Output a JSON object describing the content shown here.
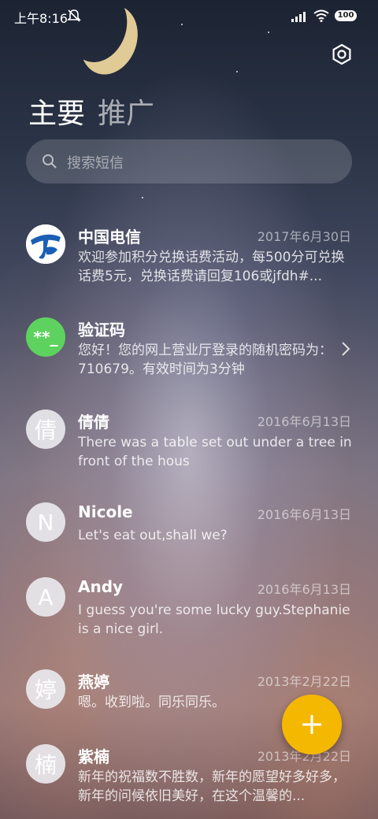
{
  "status_bar": {
    "time": "上午8:16",
    "battery": "100"
  },
  "tabs": {
    "main": "主要",
    "promotions": "推广"
  },
  "search": {
    "placeholder": "搜索短信"
  },
  "messages": [
    {
      "name": "中国电信",
      "date": "2017年6月30日",
      "preview": "欢迎参加积分兑换话费活动，每500分可兑换话费5元，兑换话费请回复106或jfdh#..."
    },
    {
      "name": "验证码",
      "avatar_text": "**_",
      "preview": "您好！您的网上营业厅登录的随机密码为：710679。有效时间为3分钟"
    },
    {
      "name": "倩倩",
      "avatar_text": "倩",
      "date": "2016年6月13日",
      "preview": "There was a table set out under a tree in front of the hous"
    },
    {
      "name": "Nicole",
      "avatar_text": "N",
      "date": "2016年6月13日",
      "preview": "Let's eat out,shall we?"
    },
    {
      "name": "Andy",
      "avatar_text": "A",
      "date": "2016年6月13日",
      "preview": "I guess you're some lucky guy.Stephanie is a nice girl."
    },
    {
      "name": "燕婷",
      "avatar_text": "婷",
      "date": "2013年2月22日",
      "preview": "嗯。收到啦。同乐同乐。"
    },
    {
      "name": "紫楠",
      "avatar_text": "楠",
      "date": "2013年2月22日",
      "preview": "新年的祝福数不胜数，新年的愿望好多好多，新年的问候依旧美好，在这个温馨的..."
    }
  ],
  "colors": {
    "fab": "#f5b800",
    "verification_avatar": "#5ed25e",
    "telecom_blue": "#1a5fb4"
  },
  "icons": [
    "mute-icon",
    "signal-icon",
    "wifi-icon",
    "settings-icon",
    "search-icon",
    "chevron-right-icon",
    "plus-icon"
  ]
}
